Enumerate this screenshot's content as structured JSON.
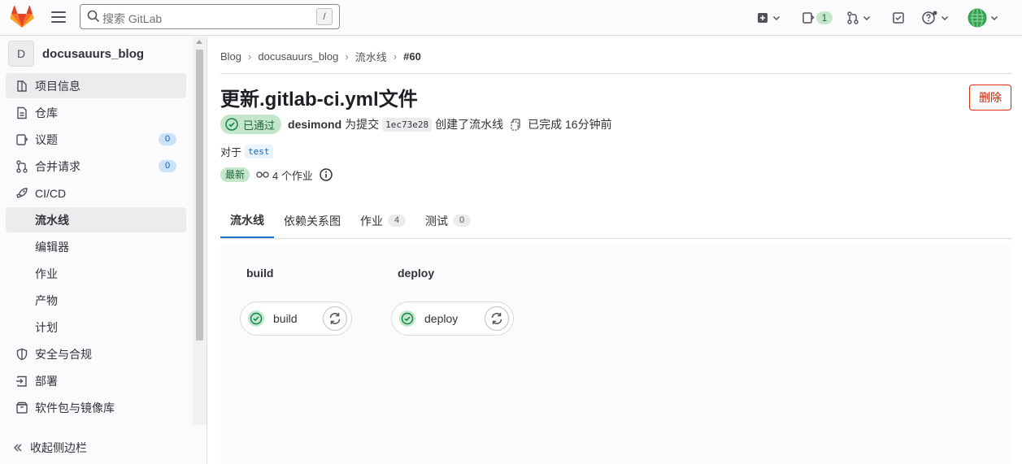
{
  "topbar": {
    "search_placeholder": "搜索 GitLab",
    "search_shortcut": "/",
    "issues_count": "1"
  },
  "sidebar": {
    "project_initial": "D",
    "project_name": "docusauurs_blog",
    "items": [
      {
        "label": "项目信息",
        "icon": "project-icon"
      },
      {
        "label": "仓库",
        "icon": "repository-icon"
      },
      {
        "label": "议题",
        "icon": "issues-icon",
        "count": "0"
      },
      {
        "label": "合并请求",
        "icon": "merge-request-icon",
        "count": "0"
      },
      {
        "label": "CI/CD",
        "icon": "rocket-icon"
      },
      {
        "label": "流水线"
      },
      {
        "label": "编辑器"
      },
      {
        "label": "作业"
      },
      {
        "label": "产物"
      },
      {
        "label": "计划"
      },
      {
        "label": "安全与合规",
        "icon": "shield-icon"
      },
      {
        "label": "部署",
        "icon": "deploy-icon"
      },
      {
        "label": "软件包与镜像库",
        "icon": "package-icon"
      }
    ],
    "collapse_label": "收起侧边栏"
  },
  "breadcrumb": {
    "items": [
      "Blog",
      "docusauurs_blog",
      "流水线"
    ],
    "current": "#60"
  },
  "pipeline": {
    "title": "更新.gitlab-ci.yml文件",
    "delete_label": "删除",
    "status": "已通过",
    "user": "desimond",
    "for_commit_text": "为提交",
    "commit_sha": "1ec73e28",
    "created_text": "创建了流水线",
    "finished_text": "已完成 16分钟前",
    "for_label": "对于",
    "branch": "test",
    "latest_label": "最新",
    "jobs_text": "4 个作业"
  },
  "tabs": [
    {
      "label": "流水线"
    },
    {
      "label": "依赖关系图"
    },
    {
      "label": "作业",
      "count": "4"
    },
    {
      "label": "测试",
      "count": "0"
    }
  ],
  "graph": {
    "stages": [
      {
        "name": "build",
        "job": "build"
      },
      {
        "name": "deploy",
        "job": "deploy"
      }
    ]
  },
  "colors": {
    "success": "#108548",
    "accent": "#1f75cb",
    "danger": "#dd2b0e"
  }
}
